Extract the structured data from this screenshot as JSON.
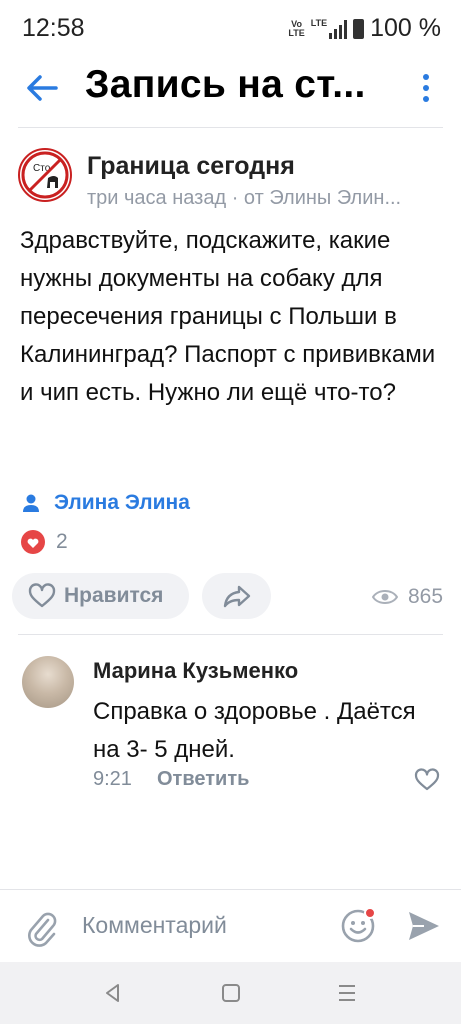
{
  "status_bar": {
    "time": "12:58",
    "battery": "100 %",
    "volte": "Vo\nLTE",
    "lte": "LTE"
  },
  "header": {
    "title": "Запись на ст..."
  },
  "post": {
    "group_name": "Граница сегодня",
    "meta": "три часа назад · от Элины Элин...",
    "text": "Здравствуйте, подскажите, какие нужны документы на собаку для пересечения границы с Польши в Калининград? Паспорт с прививками и чип есть. Нужно ли ещё что-то?",
    "author": "Элина Элина",
    "reactions_count": "2",
    "like_label": "Нравится",
    "views": "865",
    "avatar_text": "Сто"
  },
  "comment": {
    "author": "Марина Кузьменко",
    "text": "Справка о здоровье . Даётся на 3- 5 дней.",
    "time": "9:21",
    "reply_label": "Ответить"
  },
  "composer": {
    "placeholder": "Комментарий"
  },
  "colors": {
    "accent": "#2a7be0",
    "heart_red": "#e64646",
    "muted": "#818c99"
  }
}
